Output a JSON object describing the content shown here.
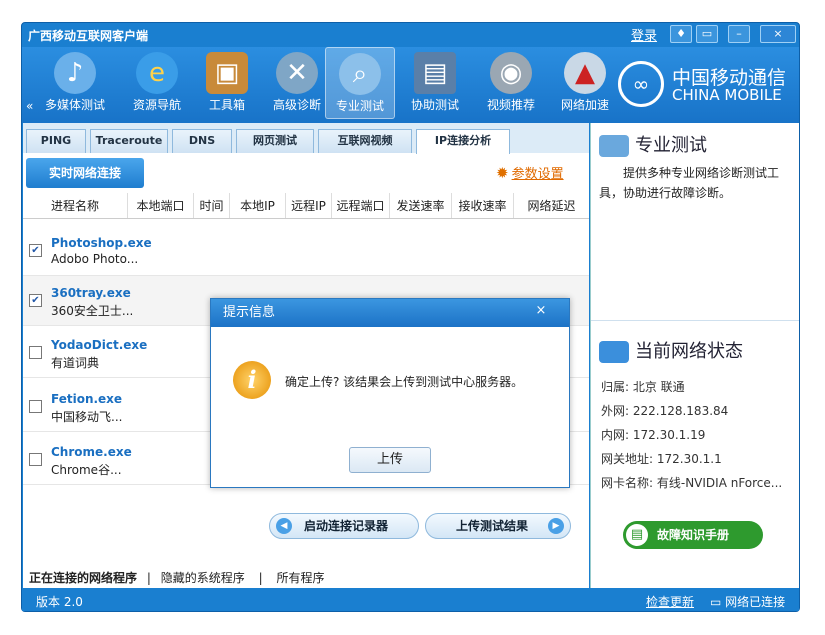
{
  "window": {
    "title": "广西移动互联网客户端",
    "login": "登录"
  },
  "toolbar": {
    "items": [
      {
        "label": "多媒体测试",
        "icon": "media-icon"
      },
      {
        "label": "资源导航",
        "icon": "ie-icon"
      },
      {
        "label": "工具箱",
        "icon": "toolbox-icon"
      },
      {
        "label": "高级诊断",
        "icon": "wrench-icon"
      },
      {
        "label": "专业测试",
        "icon": "magnifier-icon"
      },
      {
        "label": "协助测试",
        "icon": "computer-icon"
      },
      {
        "label": "视频推荐",
        "icon": "film-icon"
      },
      {
        "label": "网络加速",
        "icon": "rocket-icon"
      }
    ]
  },
  "logo": {
    "cn": "中国移动通信",
    "en": "CHINA MOBILE"
  },
  "tabs": [
    "PING",
    "Traceroute",
    "DNS",
    "网页测试",
    "互联网视频",
    "IP连接分析"
  ],
  "main": {
    "realtime_button": "实时网络连接",
    "param_link": "参数设置",
    "columns": [
      "进程名称",
      "本地端口",
      "时间",
      "本地IP",
      "远程IP",
      "远程端口",
      "发送速率",
      "接收速率",
      "网络延迟"
    ],
    "rows": [
      {
        "name": "Photoshop.exe",
        "desc": "Adobo Photo...",
        "checked": true
      },
      {
        "name": "360tray.exe",
        "desc": "360安全卫士...",
        "checked": true
      },
      {
        "name": "YodaoDict.exe",
        "desc": "有道词典",
        "checked": false
      },
      {
        "name": "Fetion.exe",
        "desc": "中国移动飞...",
        "checked": false
      },
      {
        "name": "Chrome.exe",
        "desc": "Chrome谷...",
        "checked": false
      }
    ],
    "start_button": "启动连接记录器",
    "upload_button": "上传测试结果",
    "filters": {
      "connected": "正在连接的网络程序",
      "sep": "|",
      "hidden": "隐藏的系统程序",
      "all": "所有程序"
    }
  },
  "side": {
    "pro_title": "专业测试",
    "pro_desc": "提供多种专业网络诊断测试工具，协助进行故障诊断。",
    "net_title": "当前网络状态",
    "info": [
      "归属: 北京 联通",
      "外网: 222.128.183.84",
      "内网: 172.30.1.19",
      "网关地址: 172.30.1.1",
      "网卡名称: 有线-NVIDIA nForce..."
    ],
    "manual": "故障知识手册"
  },
  "status": {
    "version": "版本 2.0",
    "update": "检查更新",
    "network": "网络已连接"
  },
  "dialog": {
    "title": "提示信息",
    "message": "确定上传? 该结果会上传到测试中心服务器。",
    "button": "上传",
    "close": "×"
  }
}
